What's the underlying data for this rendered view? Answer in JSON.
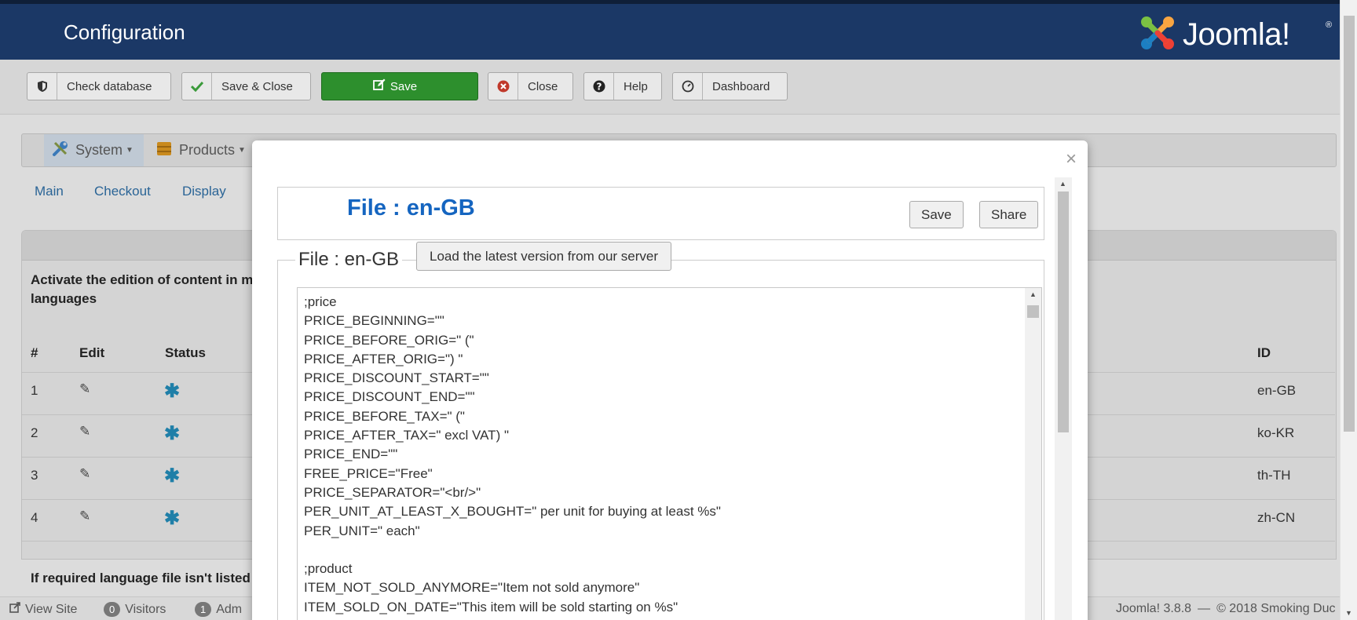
{
  "header": {
    "title": "Configuration",
    "logo_text": "Joomla!",
    "logo_reg": "®"
  },
  "toolbar": {
    "check_database": "Check database",
    "save_close": "Save & Close",
    "save": "Save",
    "close": "Close",
    "help": "Help",
    "dashboard": "Dashboard"
  },
  "menu": {
    "system": "System",
    "products": "Products"
  },
  "tabs": {
    "main": "Main",
    "checkout": "Checkout",
    "display": "Display"
  },
  "background": {
    "activate_text_1": "Activate the edition of content in m",
    "activate_text_2": "languages",
    "required_text": "If required language file isn't listed",
    "columns": {
      "num": "#",
      "edit": "Edit",
      "status": "Status",
      "id": "ID"
    },
    "rows": [
      {
        "num": "1",
        "id": "en-GB"
      },
      {
        "num": "2",
        "id": "ko-KR"
      },
      {
        "num": "3",
        "id": "th-TH"
      },
      {
        "num": "4",
        "id": "zh-CN"
      }
    ]
  },
  "statusbar": {
    "view_site": "View Site",
    "visitors_count": "0",
    "visitors": "Visitors",
    "admins_count": "1",
    "admins": "Adm",
    "version": "Joomla! 3.8.8",
    "sep": "—",
    "copyright": "© 2018 Smoking Duc"
  },
  "modal": {
    "close_symbol": "×",
    "file_title": "File : en-GB",
    "save": "Save",
    "share": "Share",
    "legend": "File : en-GB",
    "load_latest": "Load the latest version from our server",
    "editor_lines": [
      ";price",
      "PRICE_BEGINNING=\"\"",
      "PRICE_BEFORE_ORIG=\" (\"",
      "PRICE_AFTER_ORIG=\") \"",
      "PRICE_DISCOUNT_START=\"\"",
      "PRICE_DISCOUNT_END=\"\"",
      "PRICE_BEFORE_TAX=\" (\"",
      "PRICE_AFTER_TAX=\" excl VAT) \"",
      "PRICE_END=\"\"",
      "FREE_PRICE=\"Free\"",
      "PRICE_SEPARATOR=\"<br/>\"",
      "PER_UNIT_AT_LEAST_X_BOUGHT=\" per unit for buying at least %s\"",
      "PER_UNIT=\" each\"",
      "",
      ";product",
      "ITEM_NOT_SOLD_ANYMORE=\"Item not sold anymore\"",
      "ITEM_SOLD_ON_DATE=\"This item will be sold starting on %s\""
    ]
  },
  "colors": {
    "header_bg": "#1b3866",
    "save_green": "#2d8f2d",
    "file_title_blue": "#1565c0",
    "status_icon": "#1f7fa8"
  },
  "icons": [
    "shield-icon",
    "check-icon",
    "edit-icon",
    "close-circle-icon",
    "question-icon",
    "dashboard-icon",
    "wrench-icon",
    "box-icon",
    "pencil-icon",
    "status-star-icon",
    "external-link-icon",
    "joomla-logo-icon"
  ]
}
